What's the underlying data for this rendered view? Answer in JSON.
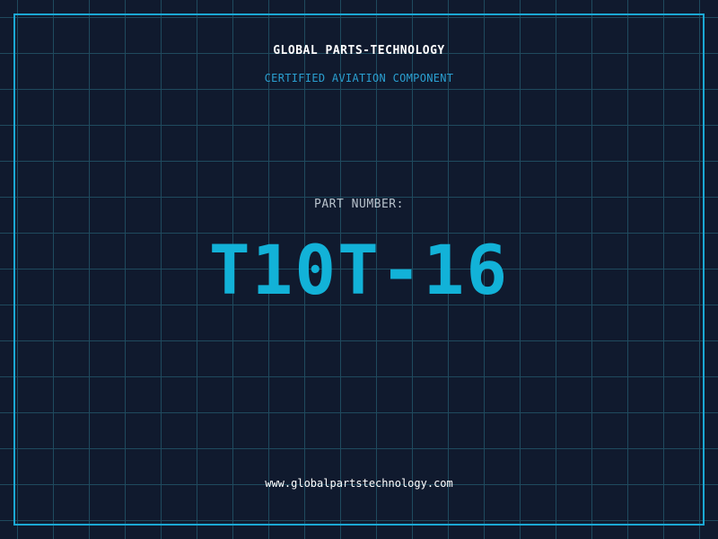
{
  "header": {
    "company": "GLOBAL PARTS-TECHNOLOGY",
    "tagline": "CERTIFIED AVIATION COMPONENT"
  },
  "part": {
    "label": "PART NUMBER:",
    "number": "T10T-16"
  },
  "footer": {
    "website": "www.globalpartstechnology.com"
  },
  "colors": {
    "background": "#101a2e",
    "grid": "#1f4a5e",
    "frame": "#1ba8d4",
    "company_text": "#ffffff",
    "tagline_text": "#2a9fd0",
    "label_text": "#b8c2cc",
    "part_number_text": "#12b2d8",
    "website_text": "#ffffff"
  }
}
